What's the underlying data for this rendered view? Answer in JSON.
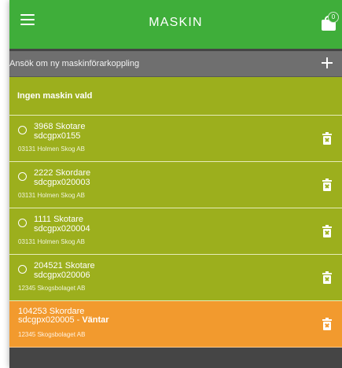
{
  "header": {
    "title": "MASKIN",
    "cart_badge": "0",
    "menu_icon": "hamburger-icon",
    "cart_icon": "shopping-bag-icon"
  },
  "apply": {
    "label": "Ansök om ny maskinförarkoppling",
    "icon": "plus-icon"
  },
  "selection": {
    "label": "Ingen maskin vald"
  },
  "machines": [
    {
      "name": "3968 Skotare",
      "code": "sdcgpx0155",
      "org": "03131 Holmen Skog AB"
    },
    {
      "name": "2222 Skordare",
      "code": "sdcgpx020003",
      "org": "03131 Holmen Skog AB"
    },
    {
      "name": "1111 Skotare",
      "code": "sdcgpx020004",
      "org": "03131 Holmen Skog AB"
    },
    {
      "name": "204521 Skotare",
      "code": "sdcgpx020006",
      "org": "12345 Skogsbolaget AB"
    }
  ],
  "pending": {
    "name": "104253 Skordare",
    "code": "sdcgpx020005",
    "separator": " - ",
    "status": "Väntar",
    "org": "12345 Skogsbolaget AB"
  },
  "colors": {
    "header_green": "#3fae3a",
    "row_olive": "#9caf1d",
    "pending_orange": "#f29a2e",
    "apply_gray": "#6f6f6f",
    "background_dark": "#454545"
  }
}
